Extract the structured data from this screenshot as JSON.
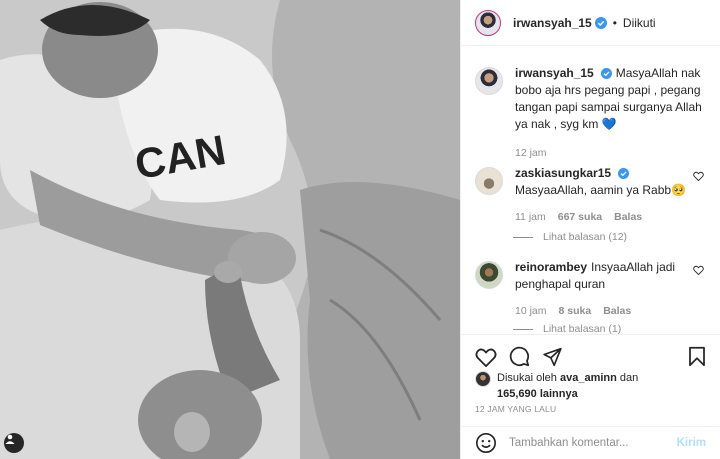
{
  "post": {
    "author": "irwansyah_15",
    "follow_state": "Diikuti",
    "caption": "MasyaAllah nak bobo aja hrs pegang papi , pegang tangan papi sampai surganya Allah ya nak , syg km 💙",
    "caption_time": "12 jam"
  },
  "comments": [
    {
      "username": "zaskiasungkar15",
      "text": "MasyaaAllah, aamin ya Rabb🥺",
      "time": "11 jam",
      "likes": "667 suka",
      "reply_label": "Balas",
      "view_replies": "Lihat balasan (12)"
    },
    {
      "username": "reinorambey",
      "text": "InsyaaAllah jadi penghapal quran",
      "time": "10 jam",
      "likes": "8 suka",
      "reply_label": "Balas",
      "view_replies": "Lihat balasan (1)"
    }
  ],
  "likes": {
    "prefix": "Disukai oleh",
    "user": "ava_aminn",
    "connector": "dan",
    "count": "165,690 lainnya"
  },
  "timestamp": "12 JAM YANG LALU",
  "composer": {
    "placeholder": "Tambahkan komentar...",
    "post_label": "Kirim"
  },
  "colors": {
    "verified": "#3897f0",
    "heart_emoji": "#1d6fd6",
    "muted": "#8e8e8e",
    "post_disabled": "#b2dffc"
  }
}
